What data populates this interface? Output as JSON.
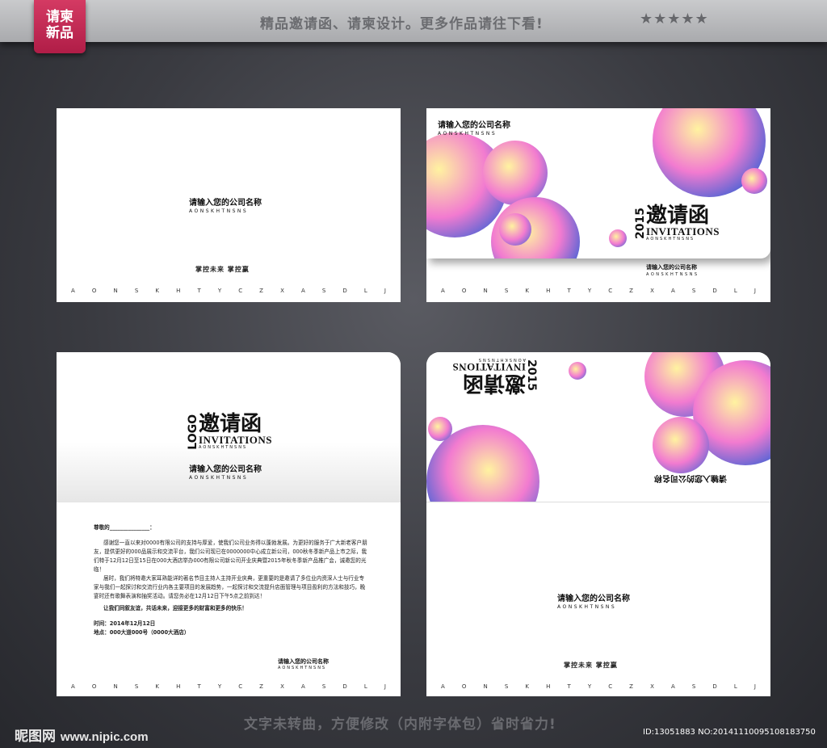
{
  "header": {
    "badge": [
      "请柬",
      "新品"
    ],
    "tagline": "精品邀请函、请柬设计。更多作品请往下看!",
    "stars": "★★★★★"
  },
  "alphabet": [
    "A",
    "O",
    "N",
    "S",
    "K",
    "H",
    "T",
    "Y",
    "C",
    "Z",
    "X",
    "A",
    "S",
    "D",
    "L",
    "J"
  ],
  "company": {
    "name": "请输入您的公司名称",
    "sub": "AONSKHTNSNS"
  },
  "slogan": "掌控未来  掌控赢",
  "title": {
    "year": "2015",
    "logo": "LOGO",
    "cn": "邀请函",
    "en": "INVITATIONS",
    "sub": "AONSKHTNSNS"
  },
  "letter": {
    "greeting": "尊敬的_______________：",
    "para1": "感谢您一直以来对0000有限公司的支持与厚爱，使我们公司业务得以蓬勃发展。为更好的服务于广大新老客户朋友，提供更好的000品展示和交流平台，我们公司现已在0000000中心成立新公司，000秋冬季新产品上市之际，我们特于12月12日至15日在000大酒店举办000有限公司新公司开业庆典暨2015年秋冬季新产品推广会，诚邀您的光临！",
    "para2": "届时，我们将特邀大家耳熟能详的著名节目主持人主持开业庆典，更重要的是邀请了多位业内资深人士与行业专家与我们一起探讨和交流行业内各主要项目的发展趋势，一起探讨和交流提升店面管理与项目盈利的方法和技巧，晚宴时还有歌舞表演和抽奖活动。请您务必在12月12日下午5点之前到达！",
    "closing": "让我们同叙友谊，共话未来，迎接更多的财富和更多的快乐！",
    "time": "时间：2014年12月12日",
    "place": "地点：000大道000号（0000大酒店）"
  },
  "footer": {
    "text": "文字未转曲，方便修改（内附字体包）省时省力!",
    "site_cn": "昵图网",
    "site_url": "www.nipic.com",
    "id": "ID:13051883 NO:20141110095108183750"
  },
  "colors": {
    "accent": "#c2244f",
    "bubble_pink": "#f27bd0",
    "bubble_blue": "#2f5fd6",
    "bubble_yellow": "#fff3a0"
  }
}
